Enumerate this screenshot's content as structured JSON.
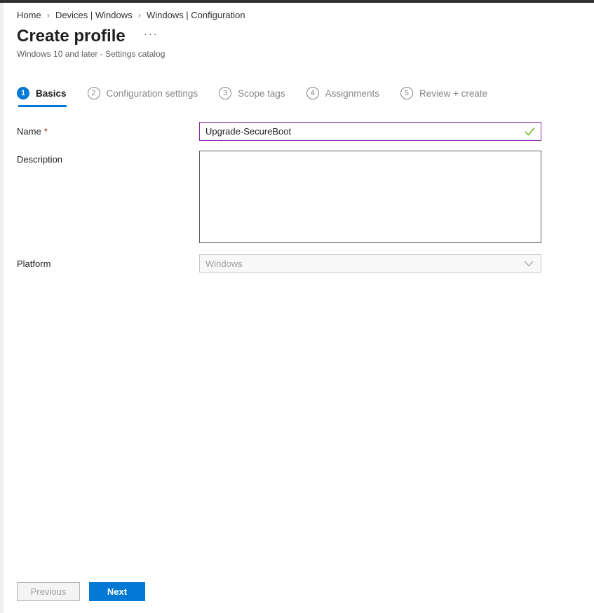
{
  "breadcrumb": {
    "items": [
      "Home",
      "Devices | Windows",
      "Windows | Configuration"
    ],
    "separator": "›"
  },
  "header": {
    "title": "Create profile",
    "menu_ellipsis": "···",
    "subtitle": "Windows 10 and later - Settings catalog"
  },
  "steps": [
    {
      "number": "1",
      "label": "Basics",
      "active": true
    },
    {
      "number": "2",
      "label": "Configuration settings",
      "active": false
    },
    {
      "number": "3",
      "label": "Scope tags",
      "active": false
    },
    {
      "number": "4",
      "label": "Assignments",
      "active": false
    },
    {
      "number": "5",
      "label": "Review + create",
      "active": false
    }
  ],
  "form": {
    "name": {
      "label": "Name",
      "required_marker": "*",
      "value": "Upgrade-SecureBoot",
      "valid": true
    },
    "description": {
      "label": "Description",
      "value": ""
    },
    "platform": {
      "label": "Platform",
      "value": "Windows",
      "disabled": true
    }
  },
  "footer": {
    "previous_label": "Previous",
    "next_label": "Next"
  },
  "colors": {
    "accent": "#0078d4",
    "dirty_field_border": "#8a2da5",
    "valid_check": "#5db300",
    "top_bar": "#323130"
  }
}
